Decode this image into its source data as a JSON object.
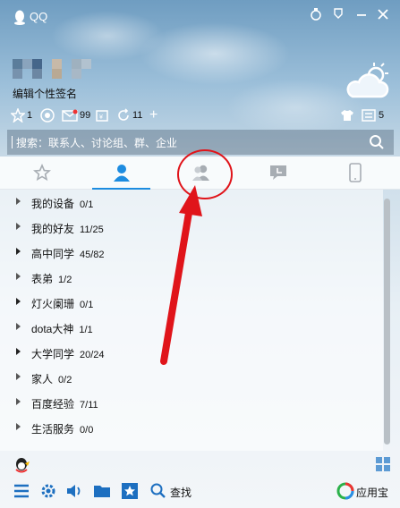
{
  "app": {
    "title": "QQ"
  },
  "profile": {
    "signature": "编辑个性签名"
  },
  "status": {
    "badge_a": "1",
    "mail_count": "99",
    "refresh_count": "11",
    "right_count": "5"
  },
  "search": {
    "placeholder": "搜索：联系人、讨论组、群、企业"
  },
  "groups": [
    {
      "name": "我的设备",
      "count": "0/1"
    },
    {
      "name": "我的好友",
      "count": "11/25"
    },
    {
      "name": "高中同学",
      "count": "45/82"
    },
    {
      "name": "表弟",
      "count": "1/2"
    },
    {
      "name": "灯火阑珊",
      "count": "0/1"
    },
    {
      "name": "dota大神",
      "count": "1/1"
    },
    {
      "name": "大学同学",
      "count": "20/24"
    },
    {
      "name": "家人",
      "count": "0/2"
    },
    {
      "name": "百度经验",
      "count": "7/11"
    },
    {
      "name": "生活服务",
      "count": "0/0"
    }
  ],
  "bottom": {
    "find_label": "查找",
    "appbox_label": "应用宝"
  },
  "colors": {
    "accent": "#1d8ce0",
    "highlight": "#e0141a"
  }
}
